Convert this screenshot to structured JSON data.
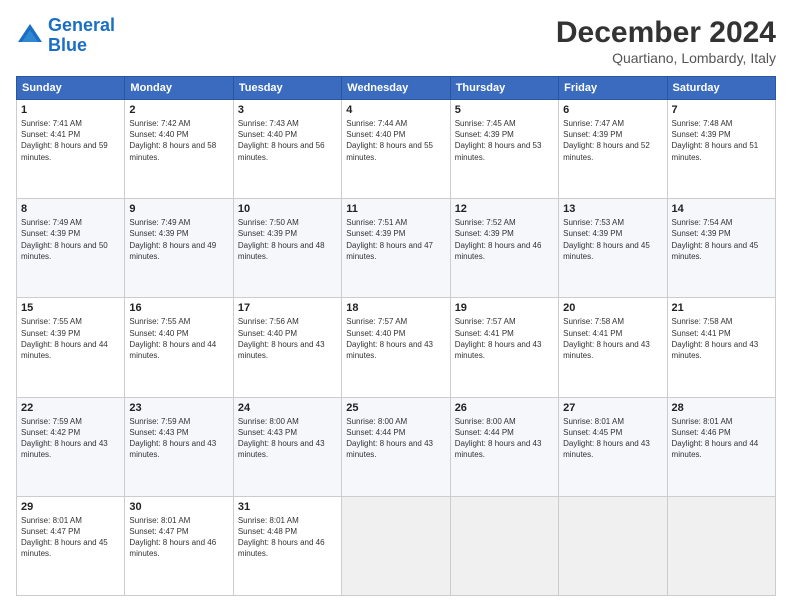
{
  "logo": {
    "line1": "General",
    "line2": "Blue"
  },
  "title": "December 2024",
  "subtitle": "Quartiano, Lombardy, Italy",
  "headers": [
    "Sunday",
    "Monday",
    "Tuesday",
    "Wednesday",
    "Thursday",
    "Friday",
    "Saturday"
  ],
  "weeks": [
    [
      {
        "day": "1",
        "rise": "Sunrise: 7:41 AM",
        "set": "Sunset: 4:41 PM",
        "light": "Daylight: 8 hours and 59 minutes."
      },
      {
        "day": "2",
        "rise": "Sunrise: 7:42 AM",
        "set": "Sunset: 4:40 PM",
        "light": "Daylight: 8 hours and 58 minutes."
      },
      {
        "day": "3",
        "rise": "Sunrise: 7:43 AM",
        "set": "Sunset: 4:40 PM",
        "light": "Daylight: 8 hours and 56 minutes."
      },
      {
        "day": "4",
        "rise": "Sunrise: 7:44 AM",
        "set": "Sunset: 4:40 PM",
        "light": "Daylight: 8 hours and 55 minutes."
      },
      {
        "day": "5",
        "rise": "Sunrise: 7:45 AM",
        "set": "Sunset: 4:39 PM",
        "light": "Daylight: 8 hours and 53 minutes."
      },
      {
        "day": "6",
        "rise": "Sunrise: 7:47 AM",
        "set": "Sunset: 4:39 PM",
        "light": "Daylight: 8 hours and 52 minutes."
      },
      {
        "day": "7",
        "rise": "Sunrise: 7:48 AM",
        "set": "Sunset: 4:39 PM",
        "light": "Daylight: 8 hours and 51 minutes."
      }
    ],
    [
      {
        "day": "8",
        "rise": "Sunrise: 7:49 AM",
        "set": "Sunset: 4:39 PM",
        "light": "Daylight: 8 hours and 50 minutes."
      },
      {
        "day": "9",
        "rise": "Sunrise: 7:49 AM",
        "set": "Sunset: 4:39 PM",
        "light": "Daylight: 8 hours and 49 minutes."
      },
      {
        "day": "10",
        "rise": "Sunrise: 7:50 AM",
        "set": "Sunset: 4:39 PM",
        "light": "Daylight: 8 hours and 48 minutes."
      },
      {
        "day": "11",
        "rise": "Sunrise: 7:51 AM",
        "set": "Sunset: 4:39 PM",
        "light": "Daylight: 8 hours and 47 minutes."
      },
      {
        "day": "12",
        "rise": "Sunrise: 7:52 AM",
        "set": "Sunset: 4:39 PM",
        "light": "Daylight: 8 hours and 46 minutes."
      },
      {
        "day": "13",
        "rise": "Sunrise: 7:53 AM",
        "set": "Sunset: 4:39 PM",
        "light": "Daylight: 8 hours and 45 minutes."
      },
      {
        "day": "14",
        "rise": "Sunrise: 7:54 AM",
        "set": "Sunset: 4:39 PM",
        "light": "Daylight: 8 hours and 45 minutes."
      }
    ],
    [
      {
        "day": "15",
        "rise": "Sunrise: 7:55 AM",
        "set": "Sunset: 4:39 PM",
        "light": "Daylight: 8 hours and 44 minutes."
      },
      {
        "day": "16",
        "rise": "Sunrise: 7:55 AM",
        "set": "Sunset: 4:40 PM",
        "light": "Daylight: 8 hours and 44 minutes."
      },
      {
        "day": "17",
        "rise": "Sunrise: 7:56 AM",
        "set": "Sunset: 4:40 PM",
        "light": "Daylight: 8 hours and 43 minutes."
      },
      {
        "day": "18",
        "rise": "Sunrise: 7:57 AM",
        "set": "Sunset: 4:40 PM",
        "light": "Daylight: 8 hours and 43 minutes."
      },
      {
        "day": "19",
        "rise": "Sunrise: 7:57 AM",
        "set": "Sunset: 4:41 PM",
        "light": "Daylight: 8 hours and 43 minutes."
      },
      {
        "day": "20",
        "rise": "Sunrise: 7:58 AM",
        "set": "Sunset: 4:41 PM",
        "light": "Daylight: 8 hours and 43 minutes."
      },
      {
        "day": "21",
        "rise": "Sunrise: 7:58 AM",
        "set": "Sunset: 4:41 PM",
        "light": "Daylight: 8 hours and 43 minutes."
      }
    ],
    [
      {
        "day": "22",
        "rise": "Sunrise: 7:59 AM",
        "set": "Sunset: 4:42 PM",
        "light": "Daylight: 8 hours and 43 minutes."
      },
      {
        "day": "23",
        "rise": "Sunrise: 7:59 AM",
        "set": "Sunset: 4:43 PM",
        "light": "Daylight: 8 hours and 43 minutes."
      },
      {
        "day": "24",
        "rise": "Sunrise: 8:00 AM",
        "set": "Sunset: 4:43 PM",
        "light": "Daylight: 8 hours and 43 minutes."
      },
      {
        "day": "25",
        "rise": "Sunrise: 8:00 AM",
        "set": "Sunset: 4:44 PM",
        "light": "Daylight: 8 hours and 43 minutes."
      },
      {
        "day": "26",
        "rise": "Sunrise: 8:00 AM",
        "set": "Sunset: 4:44 PM",
        "light": "Daylight: 8 hours and 43 minutes."
      },
      {
        "day": "27",
        "rise": "Sunrise: 8:01 AM",
        "set": "Sunset: 4:45 PM",
        "light": "Daylight: 8 hours and 43 minutes."
      },
      {
        "day": "28",
        "rise": "Sunrise: 8:01 AM",
        "set": "Sunset: 4:46 PM",
        "light": "Daylight: 8 hours and 44 minutes."
      }
    ],
    [
      {
        "day": "29",
        "rise": "Sunrise: 8:01 AM",
        "set": "Sunset: 4:47 PM",
        "light": "Daylight: 8 hours and 45 minutes."
      },
      {
        "day": "30",
        "rise": "Sunrise: 8:01 AM",
        "set": "Sunset: 4:47 PM",
        "light": "Daylight: 8 hours and 46 minutes."
      },
      {
        "day": "31",
        "rise": "Sunrise: 8:01 AM",
        "set": "Sunset: 4:48 PM",
        "light": "Daylight: 8 hours and 46 minutes."
      },
      null,
      null,
      null,
      null
    ]
  ]
}
